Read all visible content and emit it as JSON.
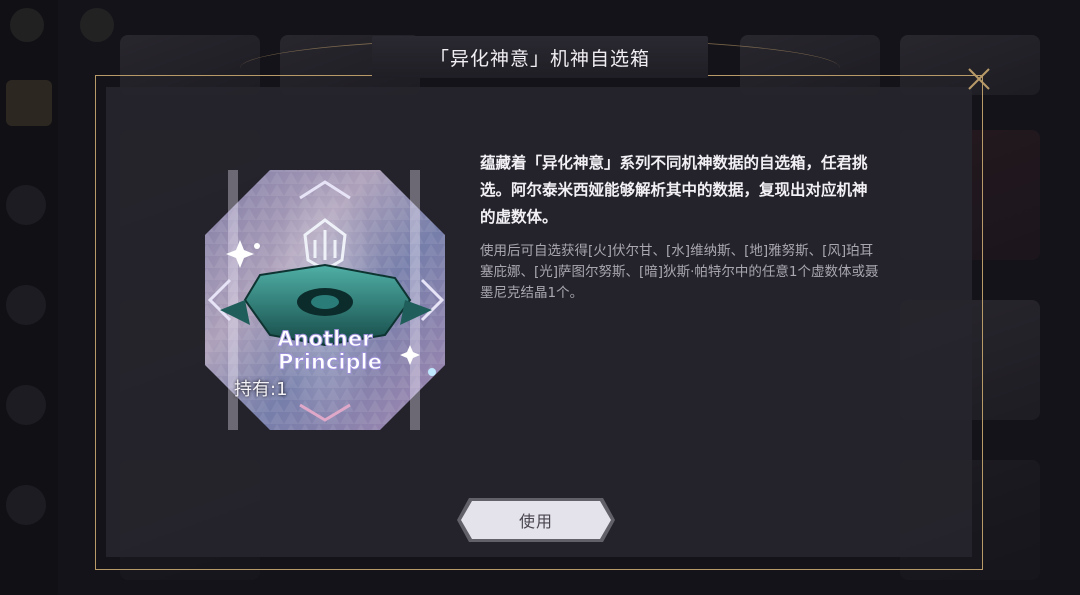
{
  "dialog": {
    "title": "「异化神意」机神自选箱",
    "close_icon": "close-icon"
  },
  "item": {
    "name_art_text_line1": "Another",
    "name_art_text_line2": "Principle",
    "owned_label": "持有:1"
  },
  "description": {
    "main": "蕴藏着「异化神意」系列不同机神数据的自选箱，任君挑选。阿尔泰米西娅能够解析其中的数据，复现出对应机神的虚数体。",
    "sub": "使用后可自选获得[火]伏尔甘、[水]维纳斯、[地]雅努斯、[风]珀耳塞庇娜、[光]萨图尔努斯、[暗]狄斯·帕特尔中的任意1个虚数体或聂墨尼克结晶1个。"
  },
  "actions": {
    "use_label": "使用"
  },
  "colors": {
    "frame_gold": "#b79a68",
    "panel_bg": "#26252d",
    "button_bg": "#e4e2ea"
  }
}
